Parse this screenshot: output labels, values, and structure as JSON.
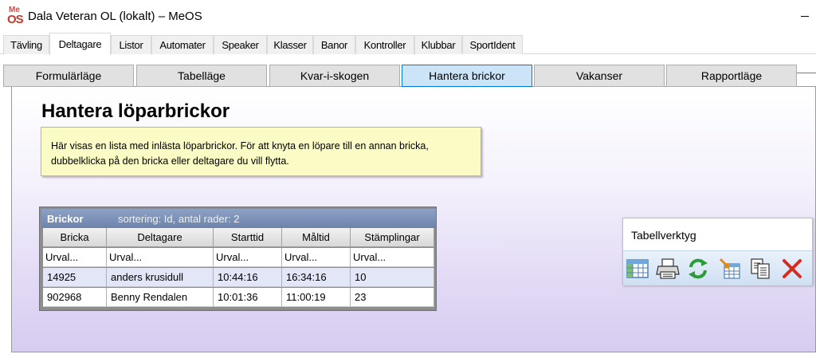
{
  "window": {
    "title": "Dala Veteran OL (lokalt) – MeOS",
    "logo_top": "Me",
    "logo_bottom": "OS"
  },
  "tabs": [
    {
      "label": "Tävling"
    },
    {
      "label": "Deltagare",
      "active": true
    },
    {
      "label": "Listor"
    },
    {
      "label": "Automater"
    },
    {
      "label": "Speaker"
    },
    {
      "label": "Klasser"
    },
    {
      "label": "Banor"
    },
    {
      "label": "Kontroller"
    },
    {
      "label": "Klubbar"
    },
    {
      "label": "SportIdent"
    }
  ],
  "subtabs": [
    {
      "label": "Formulärläge"
    },
    {
      "label": "Tabelläge"
    },
    {
      "label": "Kvar-i-skogen"
    },
    {
      "label": "Hantera brickor",
      "active": true
    },
    {
      "label": "Vakanser"
    },
    {
      "label": "Rapportläge"
    }
  ],
  "page": {
    "heading": "Hantera löparbrickor",
    "info_line1": "Här visas en lista med inlästa löparbrickor. För att knyta en löpare till en annan bricka,",
    "info_line2": "dubbelklicka på den bricka eller deltagare du vill flytta."
  },
  "table": {
    "title": "Brickor",
    "sort_info": "sortering: Id, antal rader: 2",
    "columns": [
      "Bricka",
      "Deltagare",
      "Starttid",
      "Måltid",
      "Stämplingar"
    ],
    "filters": [
      "Urval...",
      "Urval...",
      "Urval...",
      "Urval...",
      "Urval..."
    ],
    "rows": [
      [
        "14925",
        "anders krusidull",
        "10:44:16",
        "16:34:16",
        "10"
      ],
      [
        "902968",
        "Benny Rendalen",
        "10:01:36",
        "11:00:19",
        "23"
      ]
    ]
  },
  "tools": {
    "title": "Tabellverktyg",
    "icons": [
      "table-view-icon",
      "print-icon",
      "refresh-icon",
      "import-icon",
      "copy-icon",
      "delete-icon"
    ]
  }
}
